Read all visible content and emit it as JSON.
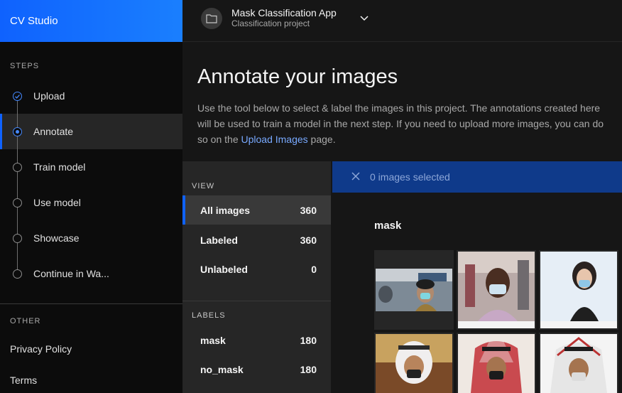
{
  "brand": "CV Studio",
  "sidebar": {
    "steps_label": "STEPS",
    "steps": [
      {
        "label": "Upload",
        "state": "done"
      },
      {
        "label": "Annotate",
        "state": "current"
      },
      {
        "label": "Train model",
        "state": "todo"
      },
      {
        "label": "Use model",
        "state": "todo"
      },
      {
        "label": "Showcase",
        "state": "todo"
      },
      {
        "label": "Continue in Wa...",
        "state": "todo"
      }
    ],
    "other_label": "OTHER",
    "privacy": "Privacy Policy",
    "terms": "Terms"
  },
  "header": {
    "project_title": "Mask Classification App",
    "project_subtitle": "Classification project",
    "folder_icon": "folder-icon",
    "chevron_icon": "chevron-down-icon"
  },
  "main": {
    "title": "Annotate your images",
    "desc_line1": "Use the tool below to select & label the images in this project. The annotations created here",
    "desc_line2": "will be used to train a model in the next step. If you need to upload more images, you can do",
    "desc_line3_pre": "so on the ",
    "desc_link": "Upload Images",
    "desc_line3_post": " page."
  },
  "view_panel": {
    "view_label": "VIEW",
    "view_rows": [
      {
        "name": "All images",
        "count": "360"
      },
      {
        "name": "Labeled",
        "count": "360"
      },
      {
        "name": "Unlabeled",
        "count": "0"
      }
    ],
    "labels_label": "LABELS",
    "label_rows": [
      {
        "name": "mask",
        "count": "180"
      },
      {
        "name": "no_mask",
        "count": "180"
      }
    ]
  },
  "selection_bar": {
    "text": "0 images selected",
    "close_icon": "close-icon"
  },
  "gallery": {
    "group_title": "mask"
  },
  "colors": {
    "accent": "#0f62fe",
    "link": "#78a9ff",
    "selection_bar": "#0f3a8a"
  }
}
